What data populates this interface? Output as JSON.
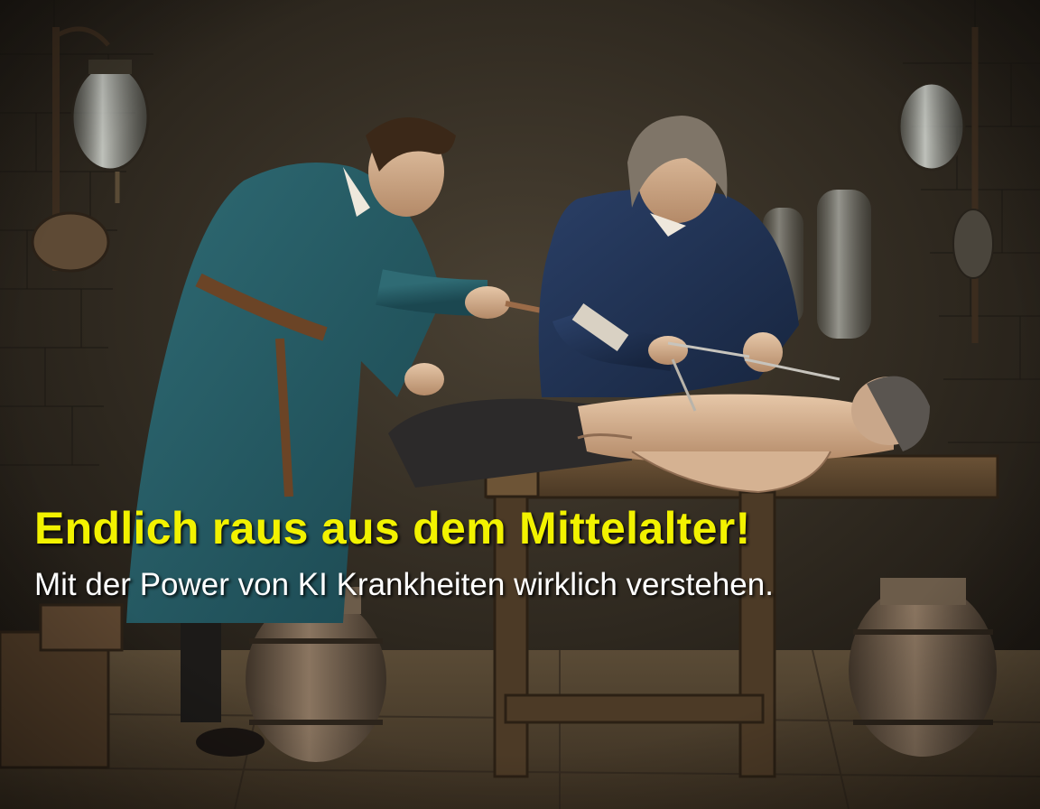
{
  "caption": {
    "headline": "Endlich raus aus dem Mittelalter!",
    "subline": "Mit der Power von KI Krankheiten wirklich verstehen."
  },
  "colors": {
    "headline": "#f2f200",
    "subline": "#ffffff",
    "background": "#2a241c"
  }
}
